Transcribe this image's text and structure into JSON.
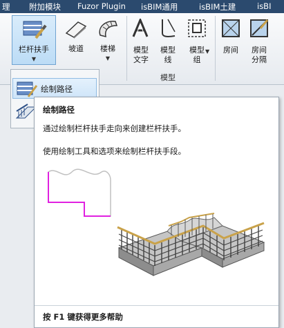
{
  "menubar": {
    "items": [
      "理",
      "附加模块",
      "Fuzor Plugin",
      "isBIM通用",
      "isBIM土建",
      "isBI"
    ]
  },
  "ribbon": {
    "buttons": [
      {
        "label": "栏杆扶手",
        "icon": "railing-icon",
        "has_dropdown": true,
        "selected": true
      },
      {
        "label": "坡道",
        "icon": "ramp-icon",
        "has_dropdown": false
      },
      {
        "label": "楼梯",
        "icon": "stair-icon",
        "has_dropdown": true
      },
      {
        "label_line1": "模型",
        "label_line2": "文字",
        "icon": "model-text-icon"
      },
      {
        "label_line1": "模型",
        "label_line2": "线",
        "icon": "model-line-icon"
      },
      {
        "label_line1": "模型",
        "label_line2": "组",
        "icon": "model-group-icon",
        "has_dropdown": true
      },
      {
        "label": "房间",
        "icon": "room-icon"
      },
      {
        "label_line1": "房间",
        "label_line2": "分隔",
        "icon": "room-separator-icon"
      }
    ],
    "panel_label": "模型"
  },
  "dropdown": {
    "items": [
      {
        "label": "绘制路径",
        "icon": "sketch-path-railing-icon",
        "hovered": true
      },
      {
        "label": "",
        "icon": "place-on-host-railing-icon"
      }
    ]
  },
  "tooltip": {
    "title": "绘制路径",
    "description": "通过绘制栏杆扶手走向来创建栏杆扶手。",
    "detail": "使用绘制工具和选项来绘制栏杆扶手段。",
    "footer_key": "按 F1 键获得更多帮助",
    "colors": {
      "path_line": "#e020e0",
      "handrail": "#c9a24a",
      "baluster": "#333333"
    }
  },
  "colors": {
    "menubar_bg": "#2b4a6e",
    "selection_border": "#6fa3d1"
  }
}
